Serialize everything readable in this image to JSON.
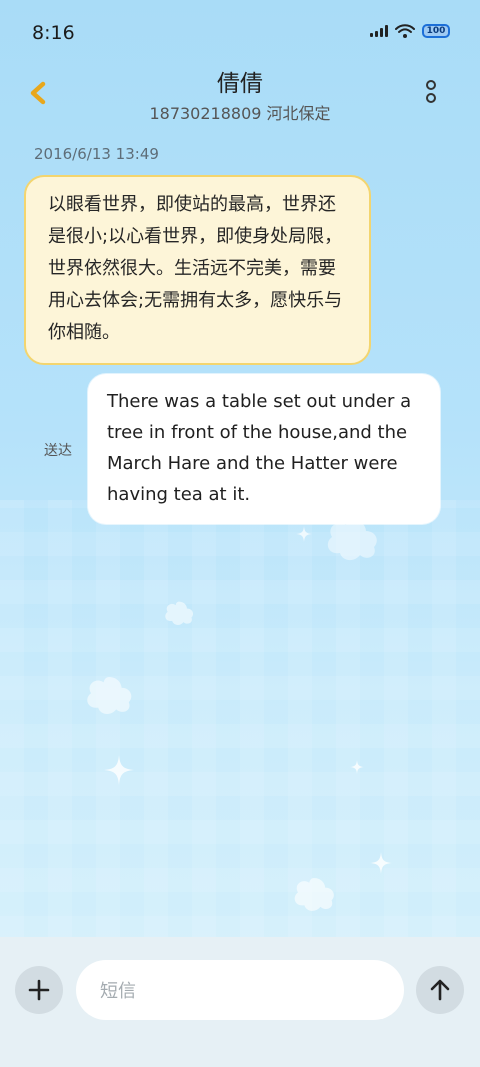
{
  "status_bar": {
    "time": "8:16",
    "battery": "100"
  },
  "header": {
    "contact_name": "倩倩",
    "contact_number_location": "18730218809 河北保定"
  },
  "conversation": {
    "timestamp": "2016/6/13 13:49",
    "received_message": "以眼看世界，即使站的最高，世界还是很小;以心看世界，即使身处局限，世界依然很大。生活远不完美，需要用心去体会;无需拥有太多，愿快乐与你相随。",
    "sent_message": "There was a table set out under a tree in front of the house,and the March Hare and the Hatter were having tea at it.",
    "sent_status": "送达"
  },
  "composer": {
    "placeholder": "短信"
  },
  "icons": {
    "back": "chevron-left-icon",
    "more": "more-vertical-icon",
    "add": "plus-icon",
    "send": "arrow-up-icon"
  },
  "colors": {
    "accent": "#e8a71c",
    "incoming_bubble_bg": "#fdf5d8",
    "incoming_bubble_border": "#f3d56f",
    "outgoing_bubble_bg": "#ffffff",
    "background_top": "#a9dcf7"
  }
}
